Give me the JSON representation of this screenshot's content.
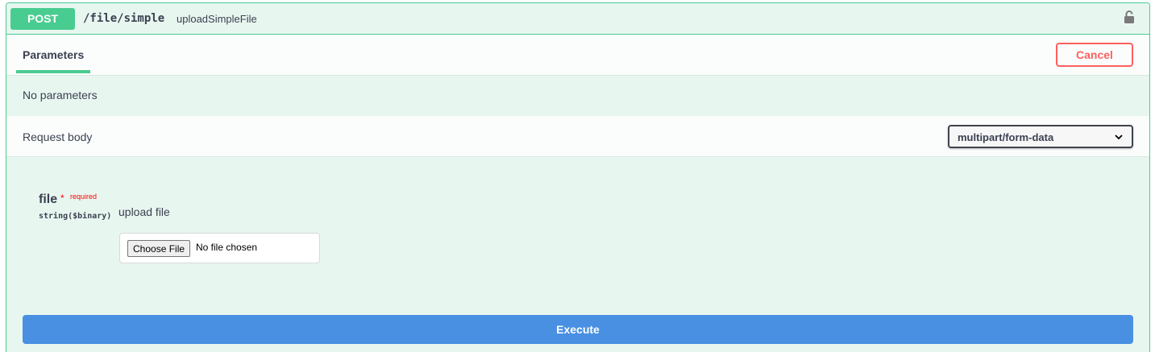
{
  "operation": {
    "method": "POST",
    "path": "/file/simple",
    "operation_id": "uploadSimpleFile"
  },
  "parameters_tab": "Parameters",
  "cancel_label": "Cancel",
  "no_parameters_text": "No parameters",
  "request_body": {
    "title": "Request body",
    "content_type": "multipart/form-data"
  },
  "param": {
    "name": "file",
    "star": "*",
    "required_label": "required",
    "type": "string($binary)",
    "description": "upload file",
    "choose_label": "Choose File",
    "no_file_text": "No file chosen"
  },
  "execute_label": "Execute",
  "colors": {
    "post_green": "#49cc90",
    "cancel_red": "#ff6060",
    "execute_blue": "#4990e2",
    "required_red": "#ff0000"
  },
  "icons": {
    "lock": "lock-icon",
    "chevron": "chevron-down-icon"
  }
}
